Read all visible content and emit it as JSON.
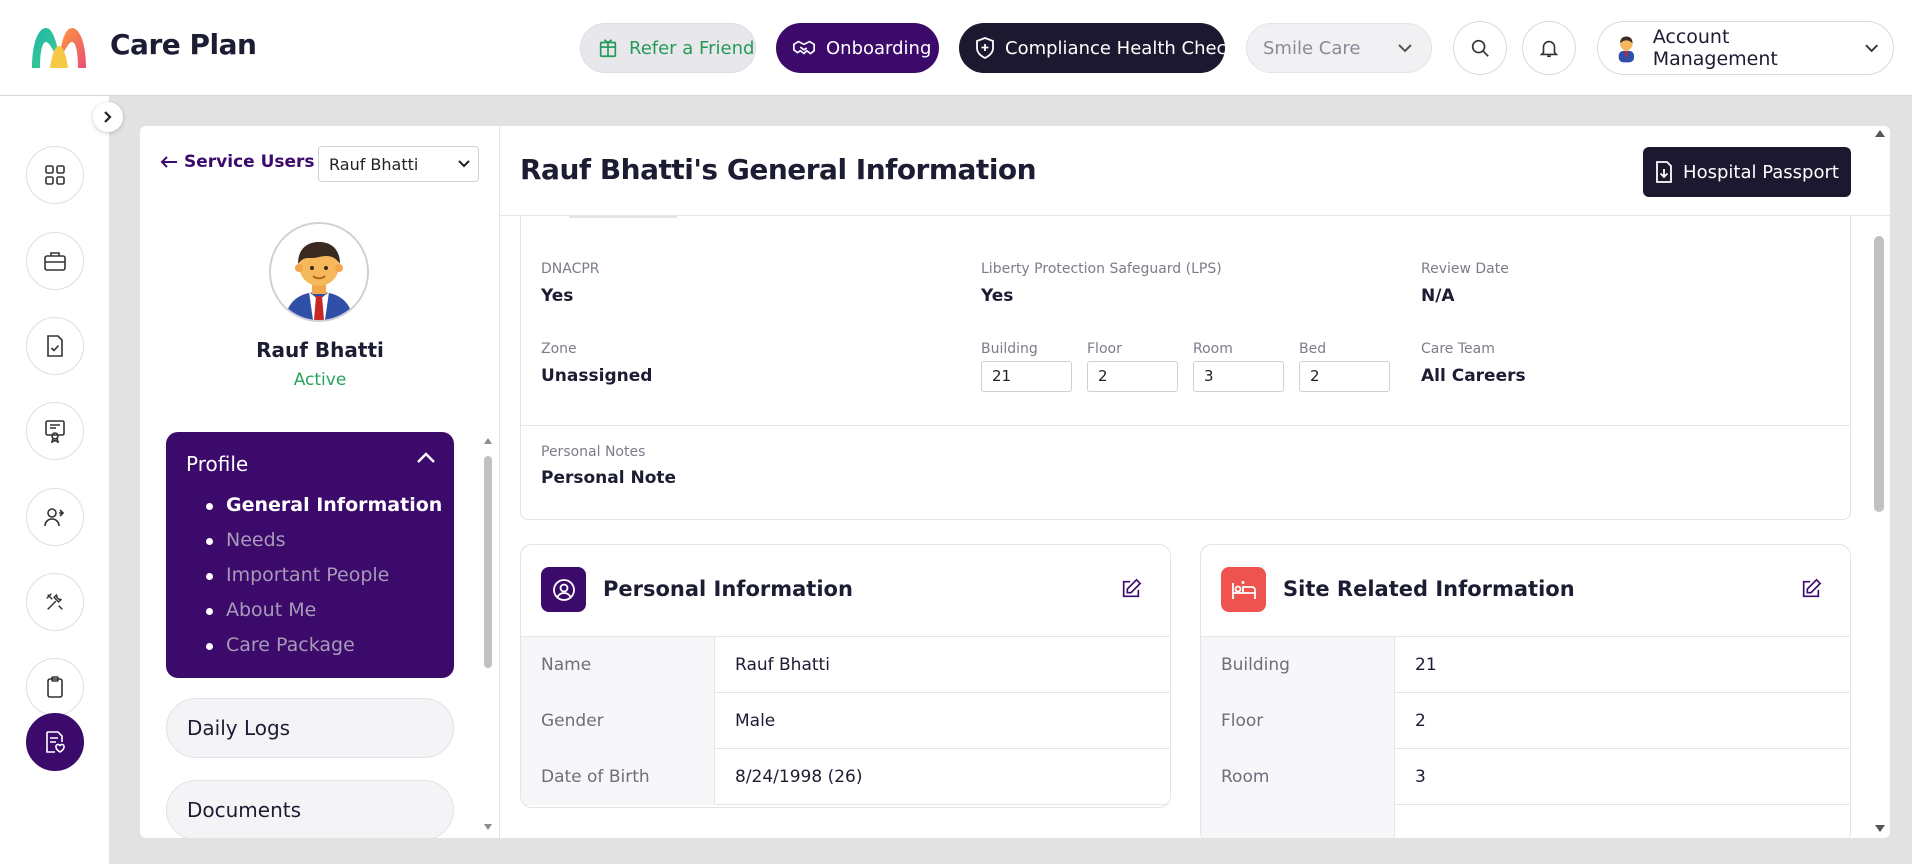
{
  "app": {
    "title": "Care Plan",
    "logo": "m-logo"
  },
  "topbar": {
    "refer_label": "Refer a Friend",
    "onboarding_label": "Onboarding",
    "compliance_label": "Compliance Health Check",
    "org_selected": "Smile Care",
    "account_label": "Account Management"
  },
  "rail": {
    "items": [
      "grid-icon",
      "briefcase-icon",
      "document-check-icon",
      "certificate-icon",
      "users-icon",
      "tools-icon",
      "clipboard-icon",
      "care-plan-icon"
    ],
    "active_index": 7
  },
  "left_panel": {
    "back_label": "Service Users",
    "user_selected": "Rauf Bhatti",
    "user_name": "Rauf Bhatti",
    "user_status": "Active",
    "profile": {
      "label": "Profile",
      "items": [
        "General Information",
        "Needs",
        "Important People",
        "About Me",
        "Care Package"
      ],
      "current": "General Information"
    },
    "daily_logs_label": "Daily Logs",
    "documents_label": "Documents"
  },
  "page": {
    "title": "Rauf Bhatti's General Information",
    "passport_label": "Hospital Passport"
  },
  "general": {
    "dnacpr": {
      "label": "DNACPR",
      "value": "Yes"
    },
    "lps": {
      "label": "Liberty Protection Safeguard (LPS)",
      "value": "Yes"
    },
    "review_date": {
      "label": "Review Date",
      "value": "N/A"
    },
    "zone": {
      "label": "Zone",
      "value": "Unassigned"
    },
    "building": {
      "label": "Building",
      "value": "21"
    },
    "floor": {
      "label": "Floor",
      "value": "2"
    },
    "room": {
      "label": "Room",
      "value": "3"
    },
    "bed": {
      "label": "Bed",
      "value": "2"
    },
    "care_team": {
      "label": "Care Team",
      "value": "All Careers"
    },
    "personal_notes": {
      "label": "Personal Notes",
      "value": "Personal Note"
    }
  },
  "personal_info": {
    "title": "Personal Information",
    "rows": [
      {
        "key": "Name",
        "value": "Rauf Bhatti"
      },
      {
        "key": "Gender",
        "value": "Male"
      },
      {
        "key": "Date of Birth",
        "value": "8/24/1998 (26)"
      }
    ]
  },
  "site_info": {
    "title": "Site Related Information",
    "rows": [
      {
        "key": "Building",
        "value": "21"
      },
      {
        "key": "Floor",
        "value": "2"
      },
      {
        "key": "Room",
        "value": "3"
      }
    ]
  },
  "colors": {
    "brand": "#3b0a6b",
    "dark": "#1c1830",
    "success": "#27a35a",
    "site_icon_bg": "#ef5350"
  }
}
